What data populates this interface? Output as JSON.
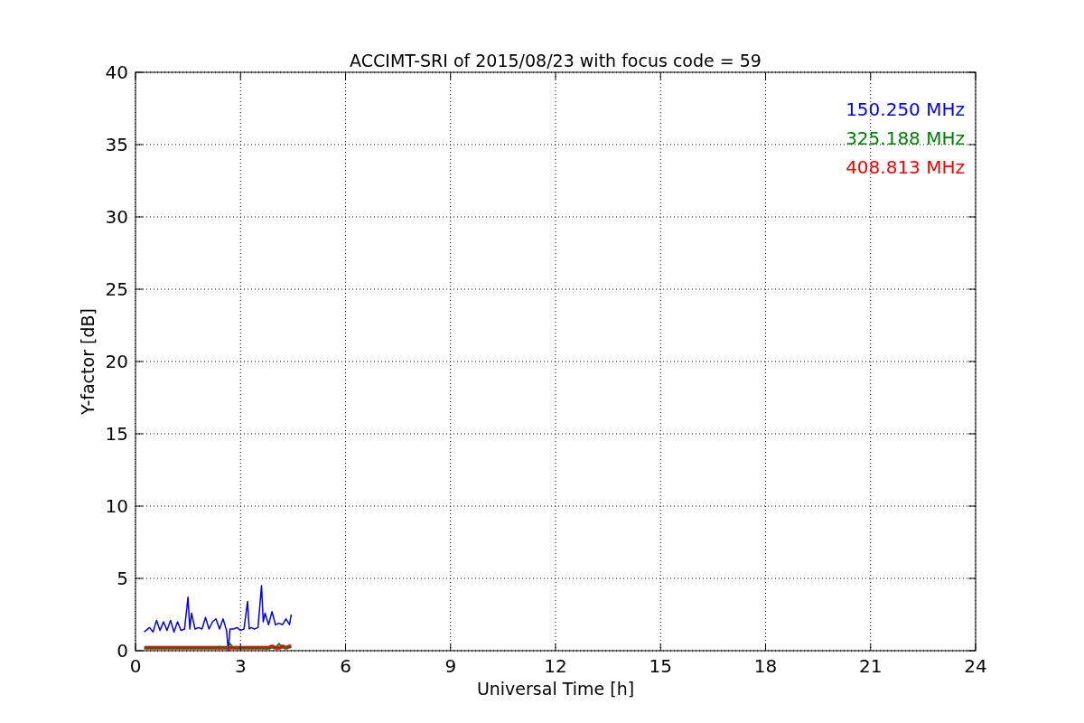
{
  "chart_data": {
    "type": "line",
    "title": "ACCIMT-SRI of 2015/08/23 with focus code = 59",
    "xlabel": "Universal Time [h]",
    "ylabel": "Y-factor [dB]",
    "x": [
      0.25,
      0.4,
      0.5,
      0.6,
      0.7,
      0.8,
      0.9,
      1.0,
      1.1,
      1.2,
      1.3,
      1.4,
      1.5,
      1.55,
      1.6,
      1.7,
      1.8,
      1.9,
      2.0,
      2.1,
      2.2,
      2.3,
      2.4,
      2.5,
      2.6,
      2.65,
      2.7,
      2.8,
      2.9,
      3.0,
      3.1,
      3.2,
      3.25,
      3.3,
      3.4,
      3.5,
      3.6,
      3.65,
      3.7,
      3.8,
      3.9,
      4.0,
      4.1,
      4.2,
      4.3,
      4.4,
      4.45
    ],
    "series": [
      {
        "name": "150.250 MHz",
        "color": "#0000ff",
        "values": [
          1.3,
          1.6,
          1.3,
          2.1,
          1.4,
          2.0,
          1.4,
          2.1,
          1.3,
          2.0,
          1.4,
          1.5,
          3.7,
          1.5,
          2.6,
          1.5,
          1.6,
          1.5,
          2.3,
          1.5,
          2.0,
          2.2,
          1.5,
          2.2,
          1.4,
          0.0,
          1.5,
          1.5,
          1.6,
          1.4,
          1.5,
          3.4,
          1.5,
          1.6,
          1.5,
          1.6,
          4.5,
          2.0,
          2.6,
          1.8,
          2.7,
          1.8,
          1.9,
          1.8,
          2.2,
          1.8,
          2.5
        ]
      },
      {
        "name": "325.188 MHz",
        "color": "#008000",
        "values": [
          0.2,
          0.2,
          0.2,
          0.2,
          0.2,
          0.2,
          0.2,
          0.2,
          0.2,
          0.2,
          0.2,
          0.2,
          0.2,
          0.2,
          0.2,
          0.2,
          0.2,
          0.2,
          0.2,
          0.2,
          0.2,
          0.2,
          0.3,
          0.2,
          0.2,
          0.2,
          0.5,
          0.2,
          0.2,
          0.2,
          0.2,
          0.2,
          0.2,
          0.2,
          0.2,
          0.2,
          0.2,
          0.2,
          0.2,
          0.2,
          0.2,
          0.2,
          0.5,
          0.2,
          0.2,
          0.3,
          0.2
        ]
      },
      {
        "name": "408.813 MHz",
        "color": "#ff0000",
        "values": [
          0.2,
          0.2,
          0.2,
          0.2,
          0.2,
          0.2,
          0.2,
          0.2,
          0.2,
          0.2,
          0.2,
          0.2,
          0.2,
          0.2,
          0.2,
          0.2,
          0.2,
          0.2,
          0.2,
          0.2,
          0.2,
          0.2,
          0.2,
          0.2,
          0.2,
          0.2,
          0.2,
          0.2,
          0.2,
          0.2,
          0.2,
          0.2,
          0.2,
          0.2,
          0.2,
          0.2,
          0.2,
          0.2,
          0.2,
          0.2,
          0.3,
          0.2,
          0.2,
          0.3,
          0.2,
          0.3,
          0.3
        ]
      }
    ],
    "xlim": [
      0,
      24
    ],
    "ylim": [
      0,
      40
    ],
    "xticks": [
      0,
      3,
      6,
      9,
      12,
      15,
      18,
      21,
      24
    ],
    "yticks": [
      0,
      5,
      10,
      15,
      20,
      25,
      30,
      35,
      40
    ],
    "grid": true
  }
}
